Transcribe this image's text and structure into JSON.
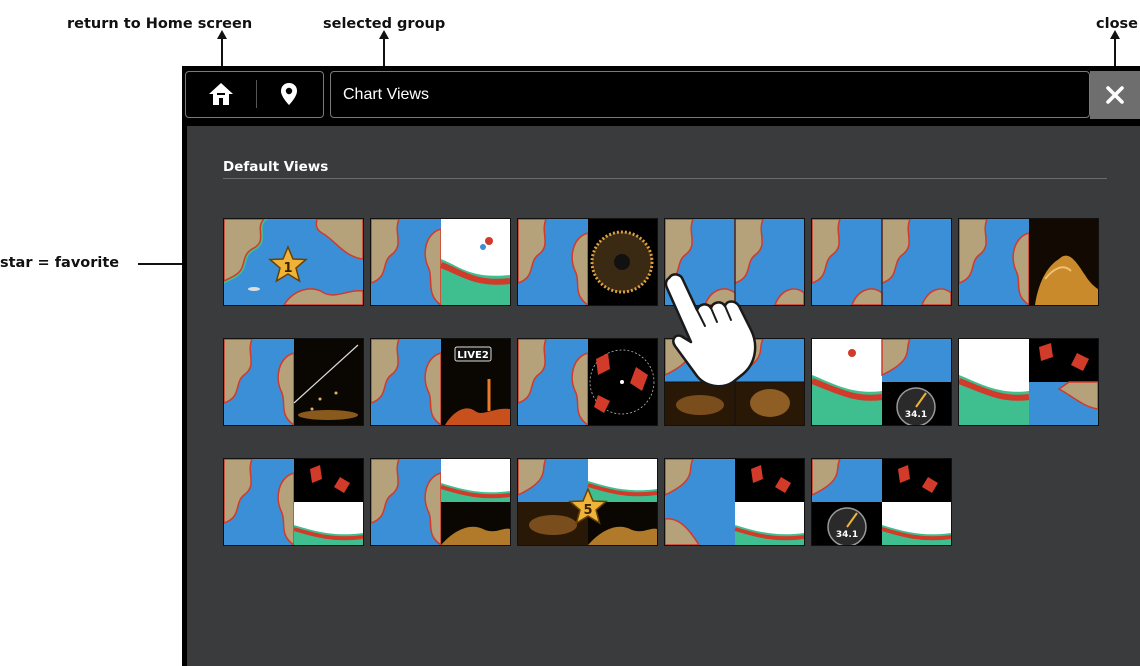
{
  "callouts": {
    "home": "return to Home screen",
    "group": "selected group",
    "close": "close",
    "favorite": "star = favorite"
  },
  "topbar": {
    "home_icon": "home-icon",
    "location_icon": "map-pin-icon",
    "selected_group": "Chart Views",
    "close_icon": "close-icon"
  },
  "section": {
    "title": "Default Views"
  },
  "tiles": [
    {
      "row": 1,
      "layout": "chart",
      "favorite": "1"
    },
    {
      "row": 1,
      "layout": "chart | 2D sonar"
    },
    {
      "row": 1,
      "layout": "chart | 360 imaging"
    },
    {
      "row": 1,
      "layout": "chart | chart"
    },
    {
      "row": 1,
      "layout": "chart | chart"
    },
    {
      "row": 1,
      "layout": "chart | side imaging"
    },
    {
      "row": 2,
      "layout": "chart | down imaging"
    },
    {
      "row": 2,
      "layout": "chart | LIVE 2D",
      "badge": "LIVE2"
    },
    {
      "row": 2,
      "layout": "chart | radar"
    },
    {
      "row": 2,
      "layout": "chart / imaging quad"
    },
    {
      "row": 2,
      "layout": "sonar | chart / gauge",
      "gauge": "34.1"
    },
    {
      "row": 2,
      "layout": "sonar | radar / chart"
    },
    {
      "row": 3,
      "layout": "chart | radar / sonar"
    },
    {
      "row": 3,
      "layout": "chart | sonar / down imaging"
    },
    {
      "row": 3,
      "layout": "chart / sonar / imaging",
      "favorite": "5"
    },
    {
      "row": 3,
      "layout": "chart | radar / chart / sonar"
    },
    {
      "row": 3,
      "layout": "chart | radar / gauge / sonar",
      "gauge": "34.1"
    }
  ],
  "colors": {
    "water": "#3a8fd6",
    "land": "#b6a27a",
    "shallow": "#3fbf8f",
    "contour": "#d23a2a",
    "star": "#f0b33a",
    "panel": "#3a3b3d"
  }
}
